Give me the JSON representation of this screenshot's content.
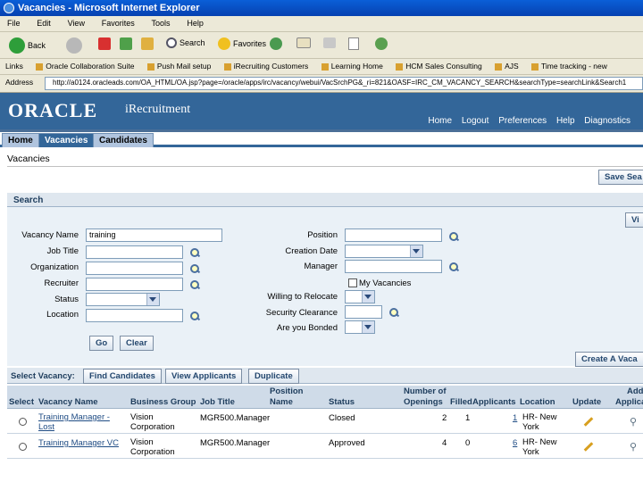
{
  "window": {
    "title": "Vacancies - Microsoft Internet Explorer"
  },
  "menu": [
    "File",
    "Edit",
    "View",
    "Favorites",
    "Tools",
    "Help"
  ],
  "toolbar": {
    "back": "Back",
    "search": "Search",
    "favorites": "Favorites"
  },
  "links_bar": {
    "label": "Links",
    "items": [
      "Oracle Collaboration Suite",
      "Push Mail setup",
      "iRecruiting Customers",
      "Learning Home",
      "HCM Sales Consulting",
      "AJS",
      "Time tracking - new"
    ]
  },
  "address": {
    "label": "Address",
    "url": "http://a0124.oracleads.com/OA_HTML/OA.jsp?page=/oracle/apps/irc/vacancy/webui/VacSrchPG&_ri=821&OASF=IRC_CM_VACANCY_SEARCH&searchType=searchLink&Search1"
  },
  "header": {
    "logo": "ORACLE",
    "product": "iRecruitment",
    "links": [
      "Home",
      "Logout",
      "Preferences",
      "Help",
      "Diagnostics"
    ]
  },
  "tabs": [
    {
      "label": "Home"
    },
    {
      "label": "Vacancies"
    },
    {
      "label": "Candidates"
    }
  ],
  "page": {
    "title": "Vacancies",
    "save_search": "Save Sea",
    "views": "Vi"
  },
  "search": {
    "section_title": "Search",
    "fields": {
      "vacancy_name": {
        "label": "Vacancy Name",
        "value": "training"
      },
      "job_title": {
        "label": "Job Title"
      },
      "organization": {
        "label": "Organization"
      },
      "recruiter": {
        "label": "Recruiter"
      },
      "status": {
        "label": "Status"
      },
      "location": {
        "label": "Location"
      },
      "position": {
        "label": "Position"
      },
      "creation_date": {
        "label": "Creation Date"
      },
      "manager": {
        "label": "Manager"
      },
      "my_vacancies": {
        "label": "My Vacancies"
      },
      "willing_to_relocate": {
        "label": "Willing to Relocate"
      },
      "security_clearance": {
        "label": "Security Clearance"
      },
      "are_you_bonded": {
        "label": "Are you Bonded"
      }
    },
    "go": "Go",
    "clear": "Clear"
  },
  "results": {
    "create_vacancy": "Create A Vaca",
    "select_label": "Select Vacancy:",
    "actions": [
      "Find Candidates",
      "View Applicants",
      "Duplicate"
    ],
    "columns": {
      "select": "Select",
      "vacancy_name": "Vacancy Name",
      "business_group": "Business Group",
      "job_title": "Job Title",
      "position_name_1": "Position",
      "position_name_2": "Name",
      "status": "Status",
      "openings_1": "Number of",
      "openings_2": "Openings",
      "filled": "Filled",
      "applicants": "Applicants",
      "location": "Location",
      "update": "Update",
      "add_1": "Add",
      "add_2": "Applica"
    },
    "rows": [
      {
        "vacancy_name_1": "Training Manager -",
        "vacancy_name_2": "Lost",
        "business_group_1": "Vision",
        "business_group_2": "Corporation",
        "job_title": "MGR500.Manager",
        "status": "Closed",
        "openings": "2",
        "filled": "1",
        "applicants": "1",
        "location_1": "HR- New",
        "location_2": "York"
      },
      {
        "vacancy_name_1": "Training Manager VC",
        "vacancy_name_2": "",
        "business_group_1": "Vision",
        "business_group_2": "Corporation",
        "job_title": "MGR500.Manager",
        "status": "Approved",
        "openings": "4",
        "filled": "0",
        "applicants": "6",
        "location_1": "HR- New",
        "location_2": "York"
      }
    ]
  },
  "colors": {
    "brand": "#336699",
    "tab_inactive": "#b0c4de",
    "section": "#dfe7ef"
  }
}
